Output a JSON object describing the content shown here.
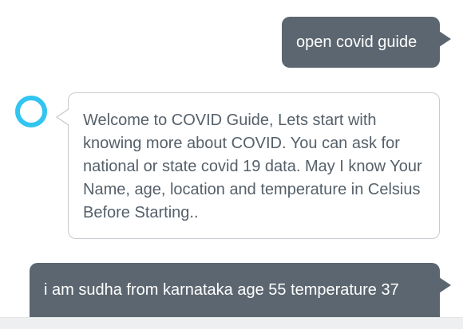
{
  "conversation": {
    "messages": [
      {
        "role": "user",
        "text": "open covid guide"
      },
      {
        "role": "assistant",
        "text": "Welcome to COVID Guide, Lets start with knowing more about COVID. You can ask for national or state covid 19 data. May I know Your Name, age, location and temperature in Celsius Before Starting.."
      },
      {
        "role": "user",
        "text": "i am sudha from karnataka age 55 temperature 37"
      }
    ]
  },
  "colors": {
    "user_bubble": "#5b6670",
    "assistant_border": "#c6cbd0",
    "assistant_text": "#55606a",
    "avatar_ring": "#31c5f0"
  },
  "icons": {
    "assistant_avatar": "alexa-ring-icon"
  }
}
